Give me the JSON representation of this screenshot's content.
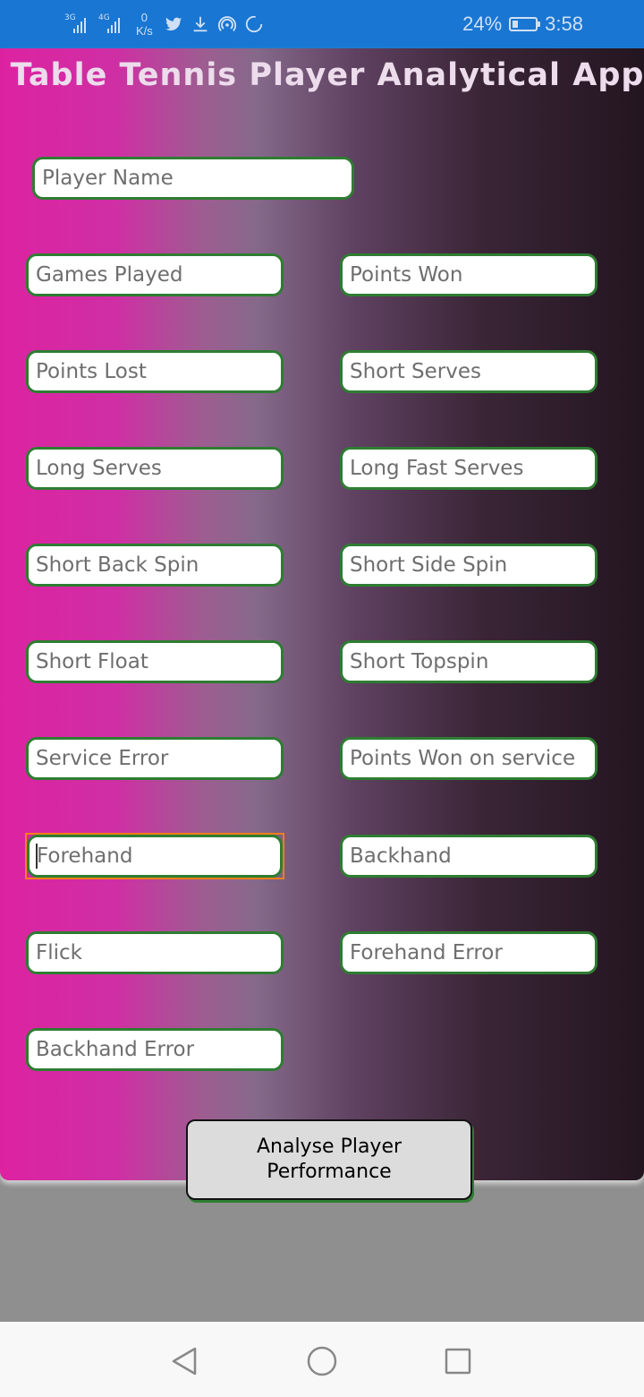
{
  "status_bar": {
    "signal1_label": "3G",
    "signal2_label": "4G",
    "net_speed_value": "0",
    "net_speed_unit": "K/s",
    "icons": [
      "twitter-icon",
      "download-icon",
      "hotspot-icon",
      "sync-icon"
    ],
    "battery_percent": "24%",
    "battery_level": 0.24,
    "time": "3:58"
  },
  "app": {
    "title": "Table Tennis Player Analytical App"
  },
  "form": {
    "player_name": {
      "placeholder": "Player Name",
      "value": ""
    },
    "fields": [
      {
        "placeholder": "Games Played",
        "value": ""
      },
      {
        "placeholder": "Points Won",
        "value": ""
      },
      {
        "placeholder": "Points Lost",
        "value": ""
      },
      {
        "placeholder": "Short Serves",
        "value": ""
      },
      {
        "placeholder": "Long Serves",
        "value": ""
      },
      {
        "placeholder": "Long Fast Serves",
        "value": ""
      },
      {
        "placeholder": "Short Back Spin",
        "value": ""
      },
      {
        "placeholder": "Short Side Spin",
        "value": ""
      },
      {
        "placeholder": "Short Float",
        "value": ""
      },
      {
        "placeholder": "Short Topspin",
        "value": ""
      },
      {
        "placeholder": "Service Error",
        "value": ""
      },
      {
        "placeholder": "Points Won on service",
        "value": ""
      },
      {
        "placeholder": "Forehand",
        "value": ""
      },
      {
        "placeholder": "Backhand",
        "value": ""
      },
      {
        "placeholder": "Flick",
        "value": ""
      },
      {
        "placeholder": "Forehand Error",
        "value": ""
      },
      {
        "placeholder": "Backhand Error",
        "value": ""
      }
    ],
    "focused_field": "Forehand",
    "submit_label": "Analyse Player Performance"
  },
  "nav_bar": {
    "icons": [
      "back-icon",
      "home-icon",
      "recents-icon"
    ]
  },
  "colors": {
    "status_bar": "#1976d2",
    "field_border": "#2e7d32",
    "focus_ring": "#f57f17",
    "gradient_start": "#dd22a1",
    "gradient_end": "#231520",
    "button_bg": "#dcdcdc"
  }
}
